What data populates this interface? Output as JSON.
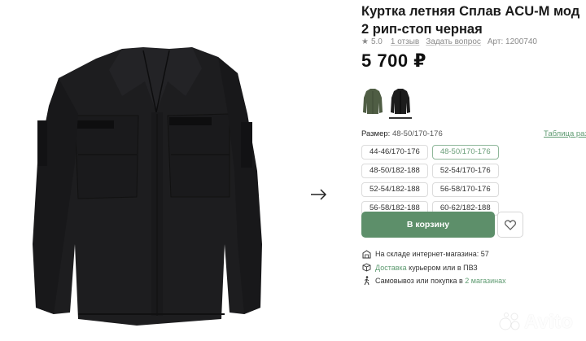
{
  "product": {
    "title": "Куртка летняя Сплав ACU-M мод 2 рип-стоп черная",
    "rating": "5.0",
    "reviews_link": "1 отзыв",
    "question_link": "Задать вопрос",
    "article": "Арт: 1200740",
    "price": "5 700 ₽"
  },
  "gallery": {
    "next_arrow_icon": "arrow-right-icon",
    "watermark": "Avito"
  },
  "colors": [
    {
      "name": "olive",
      "hex": "#4f5d44",
      "selected": false
    },
    {
      "name": "black",
      "hex": "#1c1c1c",
      "selected": true
    }
  ],
  "size": {
    "label": "Размер:",
    "selected": "48-50/170-176",
    "table_link": "Таблица разм",
    "options": [
      "44-46/170-176",
      "48-50/170-176",
      "48-50/182-188",
      "52-54/170-176",
      "52-54/182-188",
      "56-58/170-176",
      "56-58/182-188",
      "60-62/182-188"
    ]
  },
  "actions": {
    "cart": "В корзину",
    "favorite_icon": "heart-icon"
  },
  "features": {
    "stock": "На складе интернет-магазина: 57",
    "delivery_link": "Доставка",
    "delivery_rest": "курьером или в ПВЗ",
    "pickup_text": "Самовывоз или покупка в",
    "pickup_link": "2 магазинах"
  },
  "colors_theme": {
    "accent": "#5d8f6a",
    "link": "#5d9a70"
  }
}
